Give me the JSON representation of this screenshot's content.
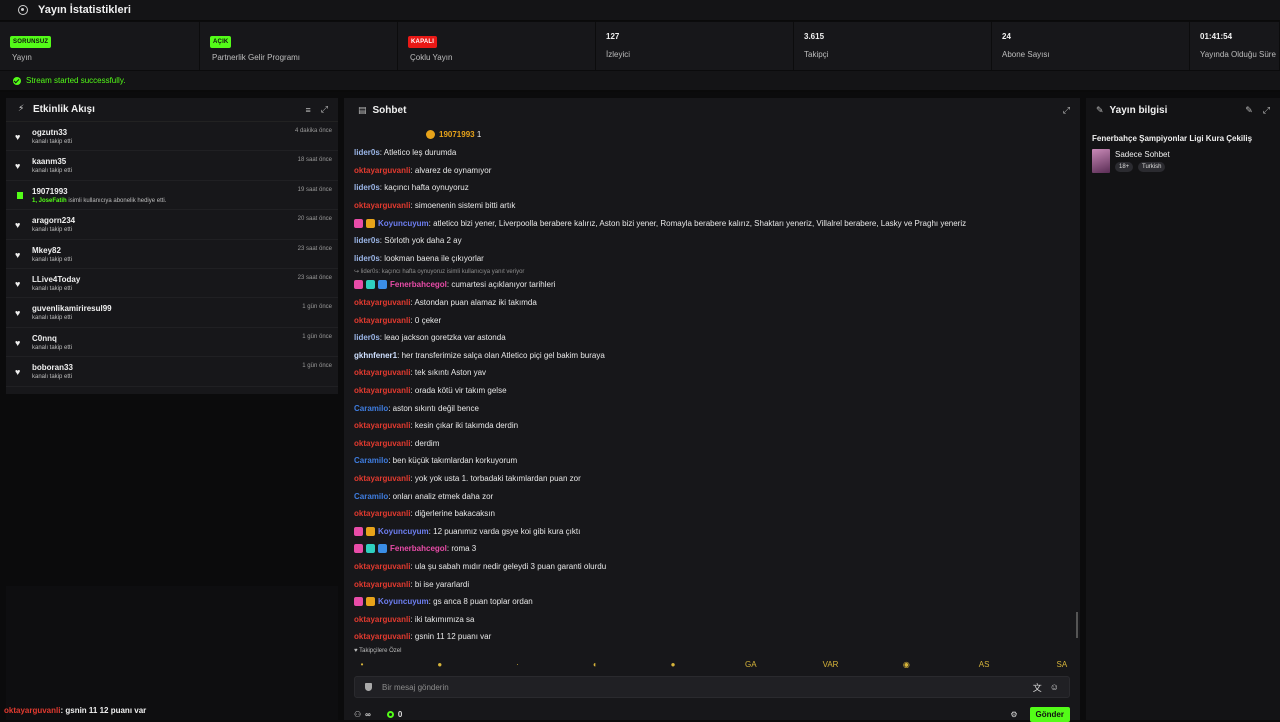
{
  "app": {
    "title": "Yayın İstatistikleri"
  },
  "stats": [
    {
      "kind": "badge",
      "badge": "SORUNSUZ",
      "badge_color": "#53fc18",
      "label": "Yayın"
    },
    {
      "kind": "badge",
      "badge": "AÇIK",
      "badge_color": "#53fc18",
      "label": "Partnerlik Gelir Programı"
    },
    {
      "kind": "badge",
      "badge": "KAPALI",
      "badge_color": "#e91916",
      "label": "Çoklu Yayın"
    },
    {
      "kind": "number",
      "value": "127",
      "label": "İzleyici"
    },
    {
      "kind": "number",
      "value": "3.615",
      "label": "Takipçi"
    },
    {
      "kind": "number",
      "value": "24",
      "label": "Abone Sayısı"
    },
    {
      "kind": "number",
      "value": "01:41:54",
      "label": "Yayında Olduğu Süre"
    }
  ],
  "notice": "Stream started successfully.",
  "activity": {
    "title": "Etkinlik Akışı",
    "items": [
      {
        "icon": "heart-icon",
        "name": "ogzutn33",
        "sub": "kanalı takip etti",
        "time": "4 dakika önce"
      },
      {
        "icon": "heart-icon",
        "name": "kaanm35",
        "sub": "kanalı takip etti",
        "time": "18 saat önce"
      },
      {
        "icon": "gift-icon",
        "name": "19071993",
        "sub_hl": "1, JoseFatih",
        "sub": "isimli kullanıcıya abonelik hediye etti.",
        "time": "19 saat önce"
      },
      {
        "icon": "heart-icon",
        "name": "aragorn234",
        "sub": "kanalı takip etti",
        "time": "20 saat önce"
      },
      {
        "icon": "heart-icon",
        "name": "Mkey82",
        "sub": "kanalı takip etti",
        "time": "23 saat önce"
      },
      {
        "icon": "heart-icon",
        "name": "LLive4Today",
        "sub": "kanalı takip etti",
        "time": "23 saat önce"
      },
      {
        "icon": "heart-icon",
        "name": "guvenlikamiriresul99",
        "sub": "kanalı takip etti",
        "time": "1 gün önce"
      },
      {
        "icon": "heart-icon",
        "name": "C0nnq",
        "sub": "kanalı takip etti",
        "time": "1 gün önce"
      },
      {
        "icon": "heart-icon",
        "name": "boboran33",
        "sub": "kanalı takip etti",
        "time": "1 gün önce"
      }
    ]
  },
  "chat": {
    "title": "Sohbet",
    "pinned": {
      "user": "19071993",
      "count": "1"
    },
    "messages": [
      {
        "user": "lider0s",
        "cls": "u-lider",
        "text": ": Atletico leş durumda"
      },
      {
        "user": "oktayarguvanli",
        "cls": "u-okt",
        "text": ": alvarez de oynamıyor"
      },
      {
        "user": "lider0s",
        "cls": "u-lider",
        "text": ": kaçıncı hafta oynuyoruz"
      },
      {
        "user": "oktayarguvanli",
        "cls": "u-okt",
        "text": ": simoenenin sistemi bitti artık"
      },
      {
        "user": "Koyuncuyum",
        "cls": "u-koy",
        "badges": [
          "#e84ca8",
          "#e7a31a"
        ],
        "text": ": atletico bizi yener, Liverpoolla berabere kalırız, Aston bizi yener, Romayla berabere kalırız, Shaktarı yeneriz, Villalrel berabere, Lasky ve Praghı yeneriz"
      },
      {
        "user": "lider0s",
        "cls": "u-lider",
        "text": ": Sörloth yok daha 2 ay"
      },
      {
        "user": "lider0s",
        "cls": "u-lider",
        "text": ": lookman baena ile çıkıyorlar"
      },
      {
        "reply": true,
        "text": "↪ lider0s: kaçıncı hafta oynuyoruz isimli kullanıcıya yanıt veriyor"
      },
      {
        "user": "Fenerbahcegol",
        "cls": "u-fen",
        "badges": [
          "#e84ca8",
          "#2fd0c0",
          "#3a8ee6"
        ],
        "text": ": cumartesi açıklanıyor tarihleri"
      },
      {
        "user": "oktayarguvanli",
        "cls": "u-okt",
        "text": ": Astondan puan alamaz iki takımda"
      },
      {
        "user": "oktayarguvanli",
        "cls": "u-okt",
        "text": ": 0 çeker"
      },
      {
        "user": "lider0s",
        "cls": "u-lider",
        "text": ": leao jackson goretzka var astonda"
      },
      {
        "user": "gkhnfener1",
        "cls": "u-gkh",
        "text": ": her transferimize salça olan Atletico piçi gel bakim buraya"
      },
      {
        "user": "oktayarguvanli",
        "cls": "u-okt",
        "text": ": tek sıkıntı Aston yav"
      },
      {
        "user": "oktayarguvanli",
        "cls": "u-okt",
        "text": ": orada kötü vir takım gelse"
      },
      {
        "user": "Caramilo",
        "cls": "u-car",
        "text": ": aston sıkıntı değil bence"
      },
      {
        "user": "oktayarguvanli",
        "cls": "u-okt",
        "text": ": kesin çıkar iki takımda derdin"
      },
      {
        "user": "oktayarguvanli",
        "cls": "u-okt",
        "text": ": derdim"
      },
      {
        "user": "Caramilo",
        "cls": "u-car",
        "text": ": ben küçük takımlardan korkuyorum"
      },
      {
        "user": "oktayarguvanli",
        "cls": "u-okt",
        "text": ": yok yok usta 1. torbadaki takımlardan puan zor"
      },
      {
        "user": "Caramilo",
        "cls": "u-car",
        "text": ": onları analiz etmek daha zor"
      },
      {
        "user": "oktayarguvanli",
        "cls": "u-okt",
        "text": ": diğerlerine bakacaksın"
      },
      {
        "user": "Koyuncuyum",
        "cls": "u-koy",
        "badges": [
          "#e84ca8",
          "#e7a31a"
        ],
        "text": ": 12 puanımız varda gsye koi gibi kura çıktı"
      },
      {
        "user": "Fenerbahcegol",
        "cls": "u-fen",
        "badges": [
          "#e84ca8",
          "#2fd0c0",
          "#3a8ee6"
        ],
        "text": ": roma 3"
      },
      {
        "user": "oktayarguvanli",
        "cls": "u-okt",
        "text": ": ula şu sabah mıdır nedir geleydi 3 puan garanti olurdu"
      },
      {
        "user": "oktayarguvanli",
        "cls": "u-okt",
        "text": ": bi ise yararlardi"
      },
      {
        "user": "Koyuncuyum",
        "cls": "u-koy",
        "badges": [
          "#e84ca8",
          "#e7a31a"
        ],
        "text": ": gs anca 8 puan toplar ordan"
      },
      {
        "user": "oktayarguvanli",
        "cls": "u-okt",
        "text": ": iki takımımıza sa"
      },
      {
        "user": "oktayarguvanli",
        "cls": "u-okt",
        "text": ": gsnin 11 12 puanı var"
      }
    ],
    "followers_only": "♥ Takipçilere Özel",
    "emotes": [
      "•",
      "●",
      "·",
      "◐",
      "●",
      "GA",
      "VAR",
      "◉",
      "AS",
      "SA"
    ],
    "placeholder": "Bir mesaj gönderin",
    "footer": {
      "infinity": "∞",
      "count": "0",
      "send": "Gönder"
    }
  },
  "stream_info": {
    "title": "Yayın bilgisi",
    "stream_title": "Fenerbahçe Şampiyonlar Ligi Kura Çekiliş",
    "category": "Sadece Sohbet",
    "tags": [
      "18+",
      "Turkish"
    ]
  },
  "overlay": {
    "user": "oktayarguvanli",
    "text": ": gsnin 11 12 puanı var"
  },
  "colors": {
    "accent": "#53fc18",
    "danger": "#e91916",
    "bg": "#17171a"
  }
}
